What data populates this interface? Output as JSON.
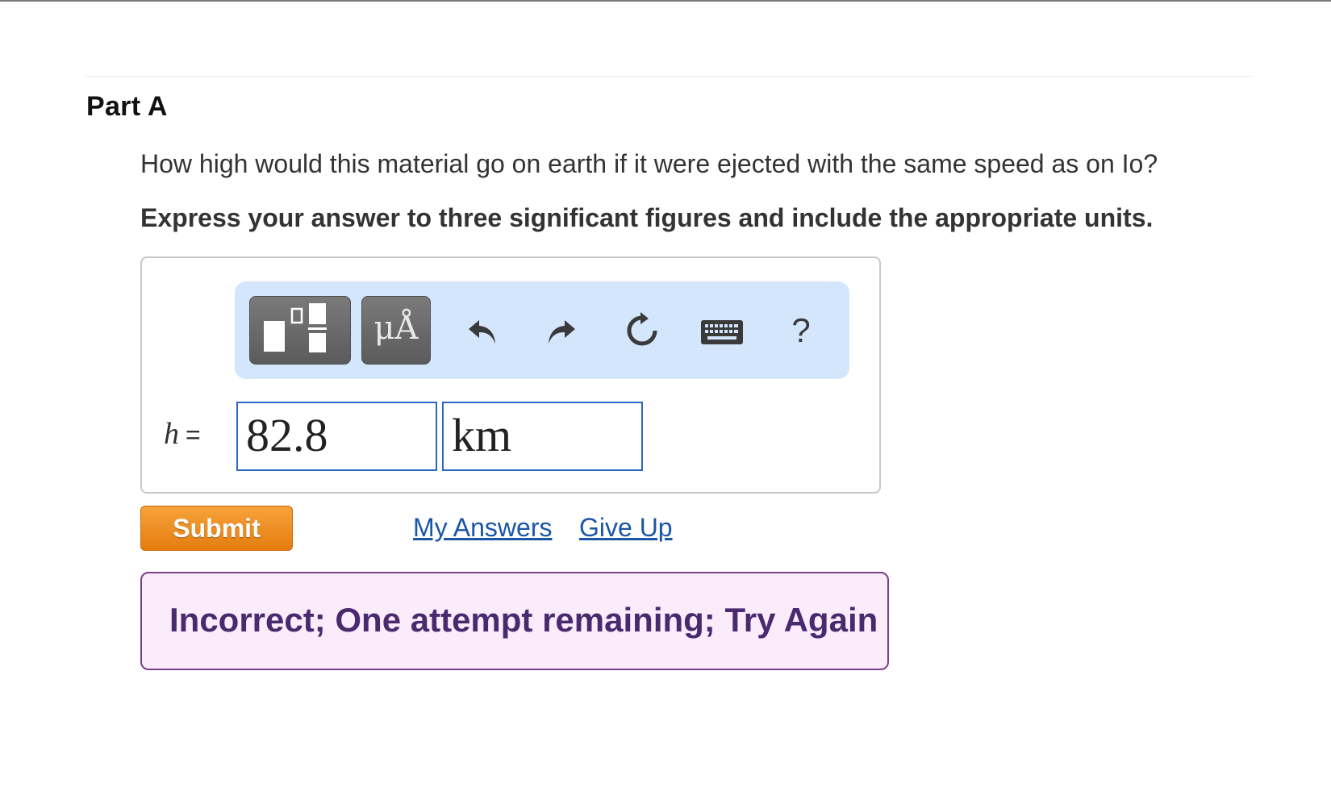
{
  "part": {
    "title": "Part A",
    "question": "How high would this material go on earth if it were ejected with the same speed as on Io?",
    "instruction": "Express your answer to three significant figures and include the appropriate units."
  },
  "toolbar": {
    "templates_icon": "templates-icon",
    "units_glyph": "μÅ",
    "undo_icon": "undo-icon",
    "redo_icon": "redo-icon",
    "reset_icon": "reset-icon",
    "keyboard_icon": "keyboard-icon",
    "help_label": "?",
    "background_color": "#d4e6fb"
  },
  "answer": {
    "variable": "h",
    "equals": "=",
    "value": "82.8",
    "unit": "km"
  },
  "actions": {
    "submit_label": "Submit",
    "my_answers_label": "My Answers",
    "give_up_label": "Give Up",
    "submit_color": "#e9871f",
    "link_color": "#1a56a8"
  },
  "feedback": {
    "message": "Incorrect; One attempt remaining; Try Again",
    "border_color": "#7a3d8a",
    "background_color": "#fbecfc"
  }
}
